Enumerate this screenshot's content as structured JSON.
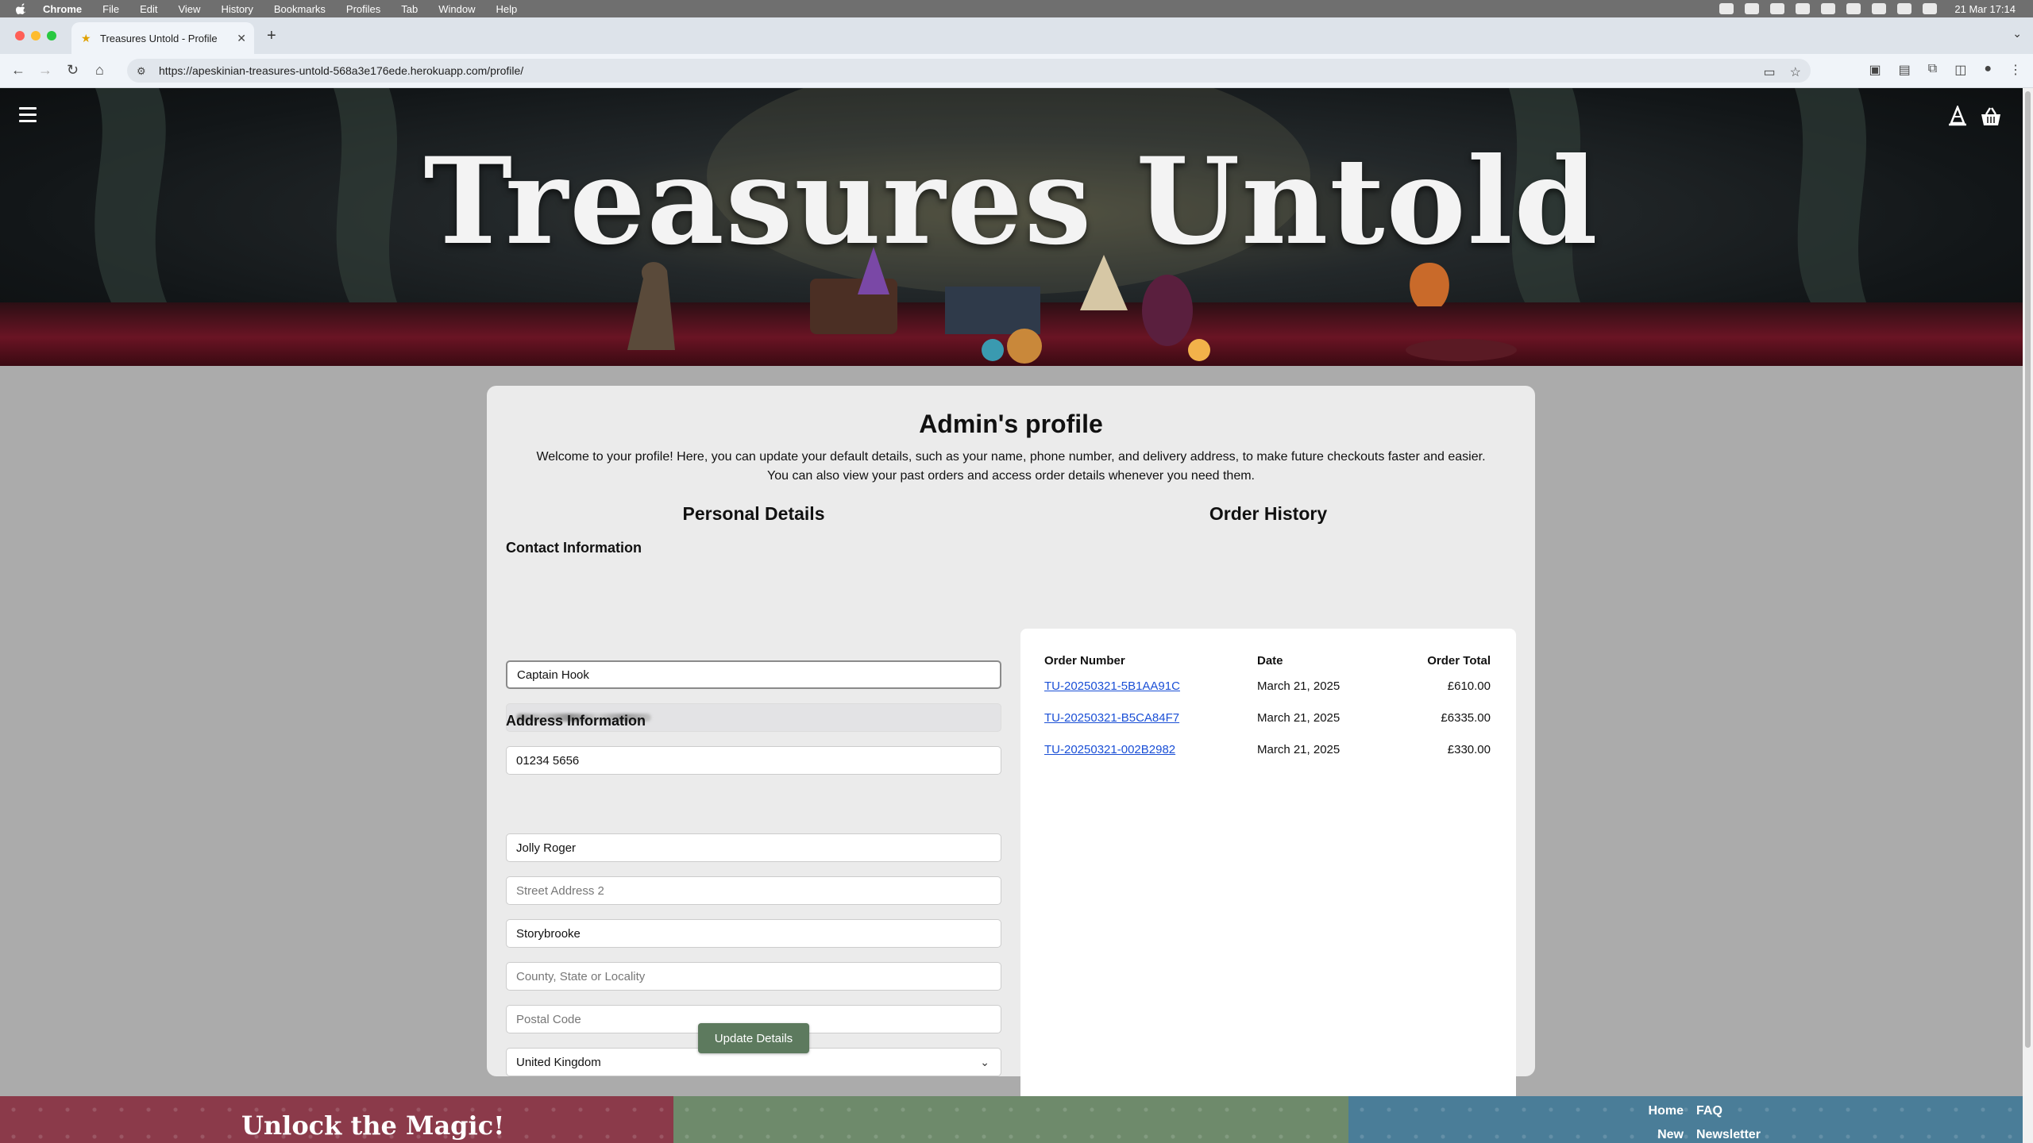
{
  "mac_menu": {
    "app": "Chrome",
    "items": [
      "File",
      "Edit",
      "View",
      "History",
      "Bookmarks",
      "Profiles",
      "Tab",
      "Window",
      "Help"
    ],
    "clock": "21 Mar  17:14"
  },
  "browser": {
    "tab_title": "Treasures Untold - Profile",
    "url": "https://apeskinian-treasures-untold-568a3e176ede.herokuapp.com/profile/"
  },
  "header": {
    "brand": "Treasures Untold"
  },
  "profile": {
    "title": "Admin's profile",
    "intro_line1": "Welcome to your profile! Here, you can update your default details, such as your name, phone number, and delivery address, to make future checkouts faster and easier.",
    "intro_line2": "You can also view your past orders and access order details whenever you need them."
  },
  "personal": {
    "heading": "Personal Details",
    "contact_heading": "Contact Information",
    "full_name": "Captain Hook",
    "phone": "01234 5656",
    "address_heading": "Address Information",
    "street1": "Jolly Roger",
    "street2_placeholder": "Street Address 2",
    "town": "Storybrooke",
    "county_placeholder": "County, State or Locality",
    "postcode_placeholder": "Postal Code",
    "country": "United Kingdom",
    "update_button": "Update Details"
  },
  "orders": {
    "heading": "Order History",
    "columns": [
      "Order Number",
      "Date",
      "Order Total"
    ],
    "rows": [
      {
        "number": "TU-20250321-5B1AA91C",
        "date": "March 21, 2025",
        "total": "£610.00"
      },
      {
        "number": "TU-20250321-B5CA84F7",
        "date": "March 21, 2025",
        "total": "£6335.00"
      },
      {
        "number": "TU-20250321-002B2982",
        "date": "March 21, 2025",
        "total": "£330.00"
      }
    ]
  },
  "footer": {
    "tagline": "Unlock the Magic!",
    "links": [
      "Home",
      "FAQ",
      "New",
      "Newsletter"
    ]
  },
  "colors": {
    "button_green": "#5d7a5e",
    "link_blue": "#1a4fd6",
    "footer_red": "#8b3a4a",
    "footer_green": "#6e8a6b",
    "footer_blue": "#4a7d98"
  }
}
